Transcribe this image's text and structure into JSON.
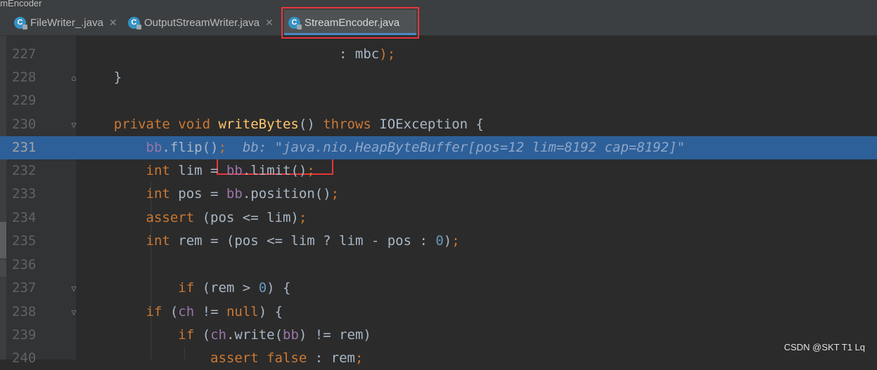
{
  "breadcrumb": "amEncoder",
  "tabs": [
    {
      "label": "FileWriter_.java",
      "icon": "java-class-icon",
      "active": false
    },
    {
      "label": "OutputStreamWriter.java",
      "icon": "java-class-icon",
      "active": false
    },
    {
      "label": "StreamEncoder.java",
      "icon": "java-class-icon",
      "active": true
    }
  ],
  "colors": {
    "background": "#2b2b2b",
    "keyword": "#cc7832",
    "method": "#ffc66d",
    "field": "#9876aa",
    "number": "#6897bb",
    "current_line": "#2d6099",
    "highlight_box": "#e8363a"
  },
  "lines": [
    {
      "number": "227",
      "code": "                                : mbc);"
    },
    {
      "number": "228",
      "code": "    }"
    },
    {
      "number": "229",
      "code": ""
    },
    {
      "number": "230",
      "code": "    private void writeBytes() throws IOException {"
    },
    {
      "number": "231",
      "code": "        bb.flip();",
      "debug_hint": "bb: \"java.nio.HeapByteBuffer[pos=12 lim=8192 cap=8192]\"",
      "current": true
    },
    {
      "number": "232",
      "code": "        int lim = bb.limit();"
    },
    {
      "number": "233",
      "code": "        int pos = bb.position();"
    },
    {
      "number": "234",
      "code": "        assert (pos <= lim);"
    },
    {
      "number": "235",
      "code": "        int rem = (pos <= lim ? lim - pos : 0);"
    },
    {
      "number": "236",
      "code": ""
    },
    {
      "number": "237",
      "code": "            if (rem > 0) {"
    },
    {
      "number": "238",
      "code": "        if (ch != null) {"
    },
    {
      "number": "239",
      "code": "            if (ch.write(bb) != rem)"
    },
    {
      "number": "240",
      "code": "                assert false : rem;"
    }
  ],
  "watermark": "CSDN @SKT T1 Lq"
}
